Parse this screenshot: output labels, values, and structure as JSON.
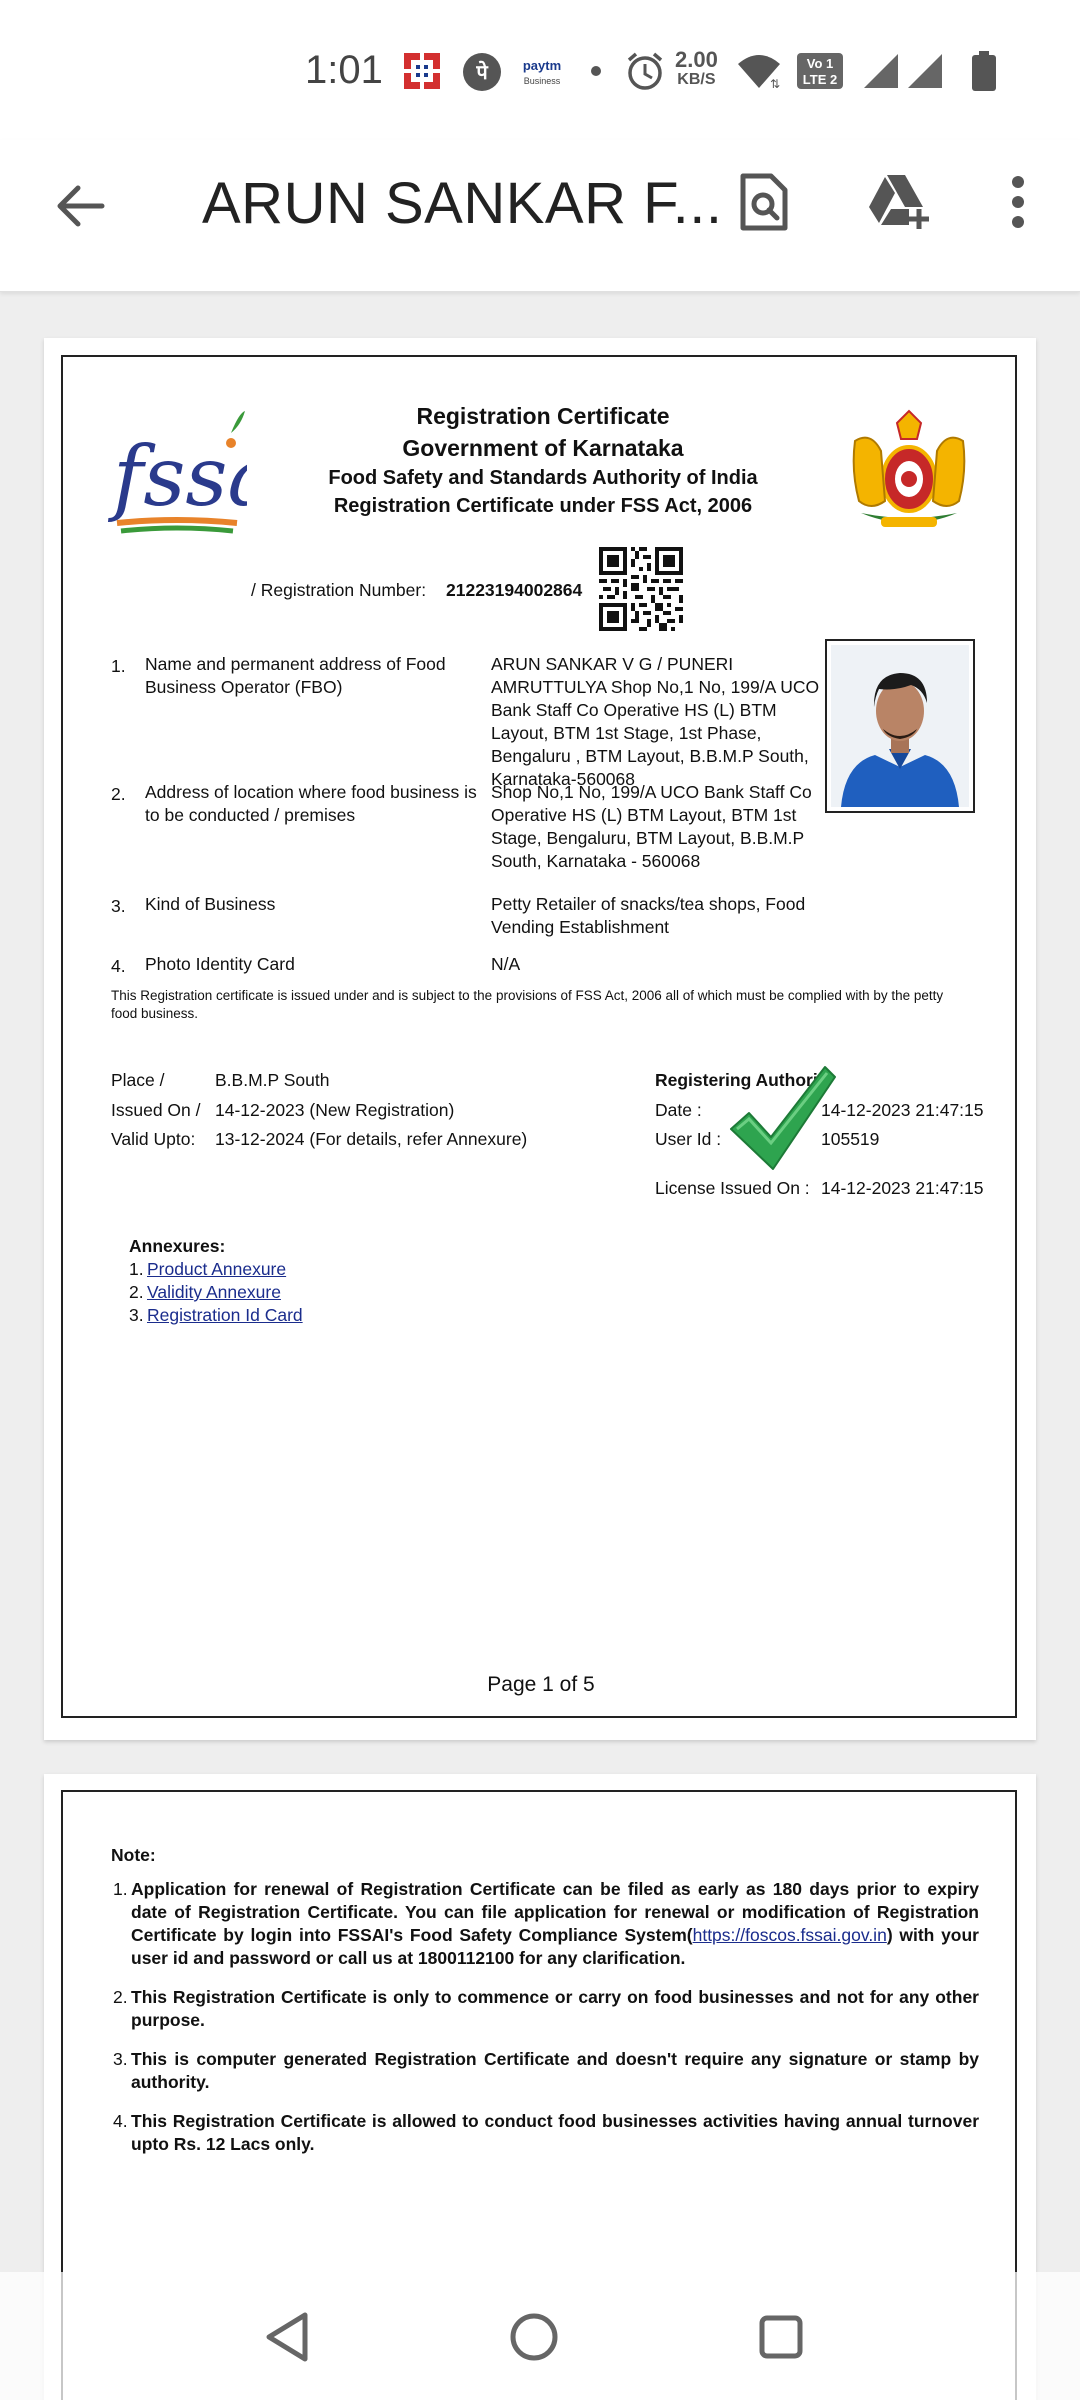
{
  "status_bar": {
    "time": "1:01",
    "speed_value": "2.00",
    "speed_unit": "KB/S",
    "icons": [
      "hdfc-icon",
      "phonepe-icon",
      "paytm-business-icon",
      "dot-icon",
      "alarm-icon",
      "wifi-icon",
      "volte-icon",
      "signal-icon",
      "signal-icon",
      "battery-icon"
    ],
    "volte_label": "Vo LTE"
  },
  "app_bar": {
    "title": "ARUN SANKAR F...",
    "icons": [
      "back-arrow-icon",
      "find-in-page-icon",
      "add-to-drive-icon",
      "more-vert-icon"
    ]
  },
  "certificate": {
    "logo_text": "fssai",
    "title": "Registration Certificate",
    "government": "Government of Karnataka",
    "authority": "Food Safety and Standards Authority of India",
    "act": "Registration Certificate under FSS Act, 2006",
    "reg_number_label": "/ Registration Number:",
    "reg_number": "21223194002864",
    "items": [
      {
        "num": "1.",
        "label": "Name and permanent address of Food Business Operator (FBO)",
        "value": "ARUN SANKAR V G / PUNERI AMRUTTULYA Shop No,1 No, 199/A UCO Bank Staff Co Operative HS (L) BTM Layout, BTM 1st Stage, 1st Phase, Bengaluru , BTM Layout, B.B.M.P South, Karnataka-560068"
      },
      {
        "num": "2.",
        "label": "Address of location where food business is to be conducted / premises",
        "value": "Shop No,1 No, 199/A UCO Bank Staff Co Operative HS (L) BTM Layout, BTM 1st Stage, Bengaluru, BTM Layout, B.B.M.P South, Karnataka - 560068"
      },
      {
        "num": "3.",
        "label": "Kind of Business",
        "value": "Petty Retailer of snacks/tea shops, Food Vending Establishment"
      },
      {
        "num": "4.",
        "label": "Photo Identity Card",
        "value": "N/A"
      }
    ],
    "disclaimer": "This Registration certificate is issued under and is subject to the provisions of FSS Act, 2006 all of which must be complied with by the petty food business.",
    "place_label": "Place /",
    "place_value": "B.B.M.P South",
    "issued_label": "Issued On /",
    "issued_value": "14-12-2023 (New Registration)",
    "valid_label": "Valid Upto:",
    "valid_value": "13-12-2024 (For details, refer Annexure)",
    "authority_heading": "Registering Authority",
    "date_label": "Date :",
    "date_value": "14-12-2023 21:47:15",
    "user_label": "User Id :",
    "user_value": "105519",
    "license_label": "License Issued On :",
    "license_value": "14-12-2023 21:47:15",
    "annexures_heading": "Annexures:",
    "annexures": [
      {
        "num": "1.",
        "label": "Product Annexure"
      },
      {
        "num": "2.",
        "label": "Validity Annexure"
      },
      {
        "num": "3.",
        "label": "Registration Id Card"
      }
    ],
    "page_indicator": "Page 1 of 5"
  },
  "note_page": {
    "heading": "Note:",
    "notes": [
      {
        "num": "1.",
        "text_before": "Application for renewal of Registration Certificate can be filed as early as 180 days prior to expiry date of Registration Certificate. You can file application for renewal or modification of Registration Certificate by login into FSSAI's Food Safety Compliance System(",
        "link": "https://foscos.fssai.gov.in",
        "text_after": ") with your user id and password or call us at 1800112100 for any clarification."
      },
      {
        "num": "2.",
        "text": "This Registration Certificate is only to commence or carry on food businesses and not for any other purpose."
      },
      {
        "num": "3.",
        "text": "This is computer generated Registration Certificate and doesn't require any signature or stamp by authority."
      },
      {
        "num": "4.",
        "text": "This Registration Certificate is allowed to conduct food businesses activities having annual turnover upto Rs. 12 Lacs only."
      }
    ]
  },
  "nav_bar": {
    "icons": [
      "back-triangle-icon",
      "home-circle-icon",
      "recents-square-icon"
    ]
  },
  "colors": {
    "check_green": "#2ea44f",
    "link_blue": "#1a2c8c",
    "fssai_blue": "#2a3a8c",
    "fssai_orange": "#e8832a",
    "fssai_green": "#3a9a3a"
  }
}
